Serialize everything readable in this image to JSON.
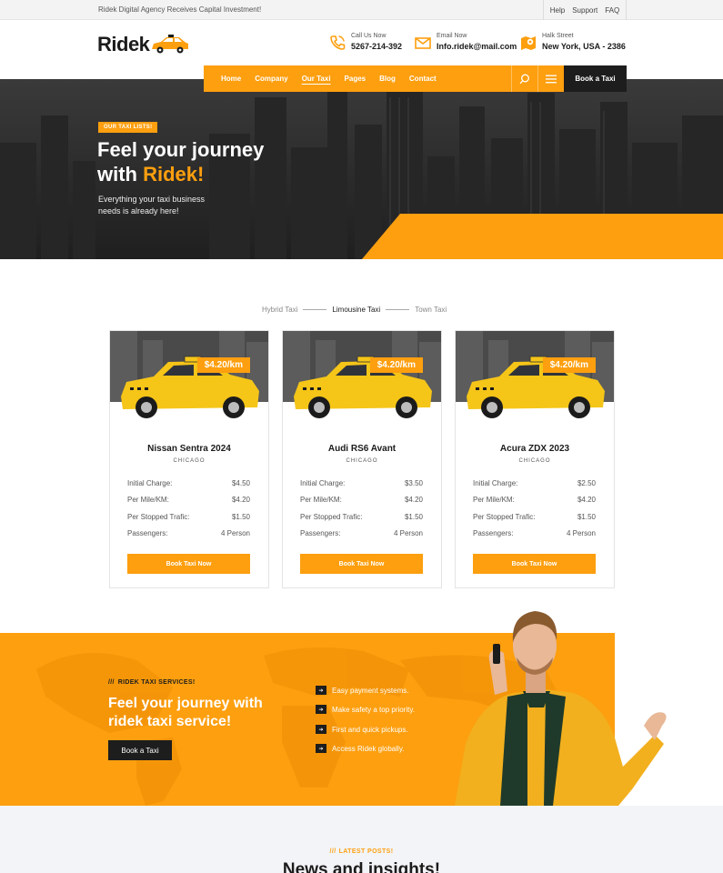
{
  "topbar": {
    "announcement": "Ridek Digital Agency Receives Capital Investment!",
    "links": [
      "Help",
      "Support",
      "FAQ"
    ]
  },
  "header": {
    "logo_text": "Ridek",
    "contacts": [
      {
        "icon": "phone-icon",
        "label": "Call Us Now",
        "value": "5267-214-392"
      },
      {
        "icon": "mail-icon",
        "label": "Email Now",
        "value": "Info.ridek@mail.com"
      },
      {
        "icon": "map-icon",
        "label": "Halk Street",
        "value": "New York, USA - 2386"
      }
    ]
  },
  "nav": {
    "items": [
      "Home",
      "Company",
      "Our Taxi",
      "Pages",
      "Blog",
      "Contact"
    ],
    "active": "Our Taxi",
    "book_label": "Book a Taxi"
  },
  "hero": {
    "tag": "OUR TAXI LISTS!",
    "title_line1": "Feel your journey",
    "title_prefix": "with ",
    "title_highlight": "Ridek!",
    "subtitle": "Everything your taxi business needs is already here!"
  },
  "tabs": [
    "Hybrid Taxi",
    "Limousine Taxi",
    "Town Taxi"
  ],
  "cards": [
    {
      "price": "$4.20/km",
      "name": "Nissan Sentra 2024",
      "city": "CHICAGO",
      "rows": [
        {
          "label": "Initial Charge:",
          "value": "$4.50"
        },
        {
          "label": "Per Mile/KM:",
          "value": "$4.20"
        },
        {
          "label": "Per Stopped Trafic:",
          "value": "$1.50"
        },
        {
          "label": "Passengers:",
          "value": "4 Person"
        }
      ],
      "cta": "Book Taxi Now"
    },
    {
      "price": "$4.20/km",
      "name": "Audi RS6 Avant",
      "city": "CHICAGO",
      "rows": [
        {
          "label": "Initial Charge:",
          "value": "$3.50"
        },
        {
          "label": "Per Mile/KM:",
          "value": "$4.20"
        },
        {
          "label": "Per Stopped Trafic:",
          "value": "$1.50"
        },
        {
          "label": "Passengers:",
          "value": "4 Person"
        }
      ],
      "cta": "Book Taxi Now"
    },
    {
      "price": "$4.20/km",
      "name": "Acura ZDX 2023",
      "city": "CHICAGO",
      "rows": [
        {
          "label": "Initial Charge:",
          "value": "$2.50"
        },
        {
          "label": "Per Mile/KM:",
          "value": "$4.20"
        },
        {
          "label": "Per Stopped Trafic:",
          "value": "$1.50"
        },
        {
          "label": "Passengers:",
          "value": "4 Person"
        }
      ],
      "cta": "Book Taxi Now"
    }
  ],
  "services": {
    "tag_slashes": "///",
    "tag": "RIDEK TAXI SERVICES!",
    "title_line1": "Feel your journey with",
    "title_line2": "ridek taxi service!",
    "button": "Book a Taxi",
    "features": [
      "Easy payment systems.",
      "Make safety a top priority.",
      "First and quick pickups.",
      "Access Ridek globally."
    ]
  },
  "latest": {
    "tag_slashes": "///",
    "tag": "LATEST POSTS!",
    "title": "News and insights!"
  },
  "colors": {
    "accent": "#fd9f0f",
    "dark": "#1d1d1d",
    "text": "#1b1b1b"
  }
}
